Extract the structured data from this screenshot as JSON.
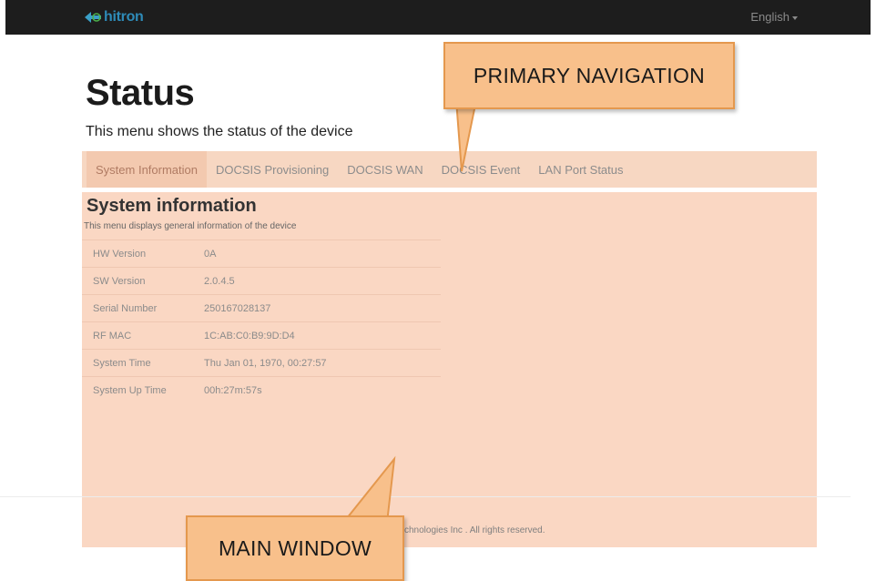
{
  "header": {
    "logo_text": "hitron",
    "language_label": "English",
    "background_color": "#1d1d1d",
    "brand_color": "#2e8bb8"
  },
  "page": {
    "title": "Status",
    "subtitle": "This menu shows the status of the device"
  },
  "tabs": [
    {
      "label": "System Information",
      "active": true
    },
    {
      "label": "DOCSIS Provisioning",
      "active": false
    },
    {
      "label": "DOCSIS WAN",
      "active": false
    },
    {
      "label": "DOCSIS Event",
      "active": false
    },
    {
      "label": "LAN Port Status",
      "active": false
    }
  ],
  "section": {
    "title": "System information",
    "description": "This menu displays general information of the device",
    "rows": [
      {
        "key": "HW Version",
        "value": "0A"
      },
      {
        "key": "SW Version",
        "value": "2.0.4.5"
      },
      {
        "key": "Serial Number",
        "value": "250167028137"
      },
      {
        "key": "RF MAC",
        "value": "1C:AB:C0:B9:9D:D4"
      },
      {
        "key": "System Time",
        "value": "Thu Jan 01, 1970, 00:27:57"
      },
      {
        "key": "System Up Time",
        "value": "00h:27m:57s"
      }
    ]
  },
  "footer": {
    "copyright": "chnologies Inc . All rights reserved."
  },
  "callouts": {
    "primary_navigation": "PRIMARY NAVIGATION",
    "main_window": "MAIN WINDOW",
    "fill_color": "#f8c08b",
    "highlight_color": "#fad7c3"
  }
}
